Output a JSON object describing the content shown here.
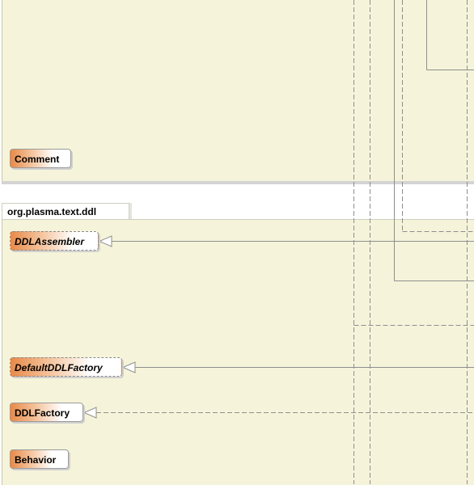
{
  "diagram": {
    "packages": [
      {
        "name": ""
      },
      {
        "name": "org.plasma.text.ddl"
      }
    ],
    "classes": [
      {
        "id": "comment",
        "label": "Comment",
        "abstract": false
      },
      {
        "id": "ddl-assembler",
        "label": "DDLAssembler",
        "abstract": true
      },
      {
        "id": "default-ddl-factory",
        "label": "DefaultDDLFactory",
        "abstract": true
      },
      {
        "id": "ddl-factory",
        "label": "DDLFactory",
        "abstract": false
      },
      {
        "id": "behavior",
        "label": "Behavior",
        "abstract": false
      }
    ],
    "relations": [
      {
        "target": "DDLAssembler",
        "kind": "generalization",
        "line": "solid"
      },
      {
        "target": "DefaultDDLFactory",
        "kind": "generalization",
        "line": "solid"
      },
      {
        "target": "DDLFactory",
        "kind": "realization",
        "line": "dashed"
      }
    ],
    "colors": {
      "package_fill": "#f5f4da",
      "class_gradient_start": "#e88a48",
      "line": "#888888"
    }
  }
}
